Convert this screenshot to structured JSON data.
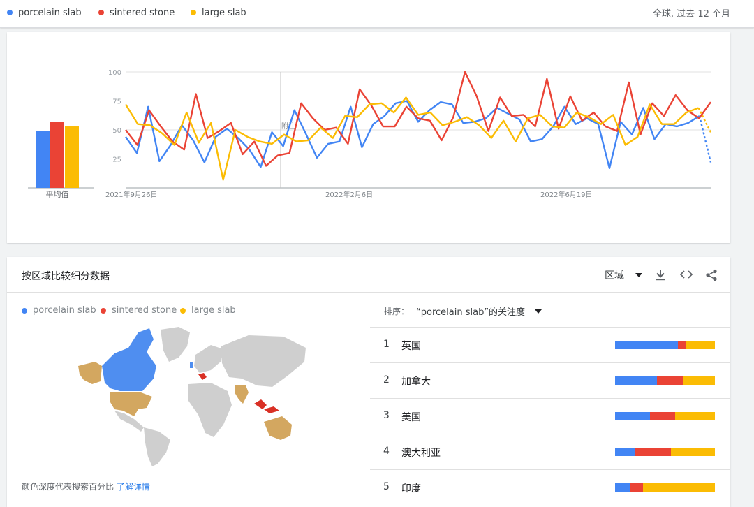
{
  "legend": [
    {
      "name": "porcelain slab",
      "color": "#4285f4"
    },
    {
      "name": "sintered stone",
      "color": "#ea4335"
    },
    {
      "name": "large slab",
      "color": "#fbbc04"
    }
  ],
  "scope": "全球, 过去 12 个月",
  "averages": {
    "label": "平均值",
    "values": [
      49,
      57,
      53
    ]
  },
  "note_marker": "附注",
  "chart_data": {
    "type": "line",
    "ylim": [
      0,
      100
    ],
    "yticks": [
      25,
      50,
      75,
      100
    ],
    "xtick_labels": [
      "2021年9月26日",
      "2022年2月6日",
      "2022年6月19日"
    ],
    "series": [
      {
        "name": "porcelain slab",
        "color": "#4285f4",
        "values": [
          44,
          30,
          70,
          23,
          37,
          54,
          41,
          22,
          44,
          51,
          43,
          33,
          18,
          48,
          36,
          67,
          47,
          26,
          38,
          40,
          70,
          35,
          55,
          62,
          73,
          75,
          57,
          67,
          74,
          72,
          56,
          57,
          60,
          69,
          64,
          59,
          40,
          42,
          53,
          70,
          55,
          60,
          55,
          17,
          57,
          46,
          69,
          42,
          55,
          53,
          56,
          62,
          22
        ]
      },
      {
        "name": "sintered stone",
        "color": "#ea4335",
        "values": [
          50,
          37,
          67,
          53,
          40,
          33,
          81,
          43,
          49,
          56,
          29,
          40,
          19,
          28,
          30,
          73,
          60,
          50,
          52,
          38,
          85,
          71,
          53,
          53,
          70,
          60,
          58,
          41,
          61,
          100,
          79,
          49,
          78,
          62,
          63,
          53,
          94,
          51,
          79,
          58,
          65,
          53,
          49,
          91,
          46,
          73,
          62,
          80,
          67,
          60,
          74
        ]
      },
      {
        "name": "large slab",
        "color": "#fbbc04",
        "values": [
          72,
          55,
          54,
          47,
          37,
          65,
          39,
          56,
          7,
          50,
          44,
          40,
          38,
          46,
          40,
          41,
          52,
          43,
          62,
          61,
          72,
          73,
          65,
          78,
          63,
          65,
          54,
          57,
          61,
          54,
          43,
          58,
          40,
          60,
          63,
          53,
          52,
          65,
          61,
          55,
          63,
          37,
          44,
          72,
          55,
          55,
          65,
          69,
          48
        ]
      }
    ]
  },
  "region": {
    "title": "按区域比较细分数据",
    "selector": "区域",
    "sort_label": "排序：",
    "sort_value": "“porcelain slab”的关注度",
    "footer_text": "颜色深度代表搜索百分比",
    "footer_link": "了解详情",
    "rows": [
      {
        "rank": "1",
        "name": "英国",
        "shares": [
          63,
          8,
          29
        ]
      },
      {
        "rank": "2",
        "name": "加拿大",
        "shares": [
          42,
          26,
          32
        ]
      },
      {
        "rank": "3",
        "name": "美国",
        "shares": [
          35,
          25,
          40
        ]
      },
      {
        "rank": "4",
        "name": "澳大利亚",
        "shares": [
          20,
          36,
          44
        ]
      },
      {
        "rank": "5",
        "name": "印度",
        "shares": [
          15,
          13,
          72
        ]
      }
    ]
  }
}
